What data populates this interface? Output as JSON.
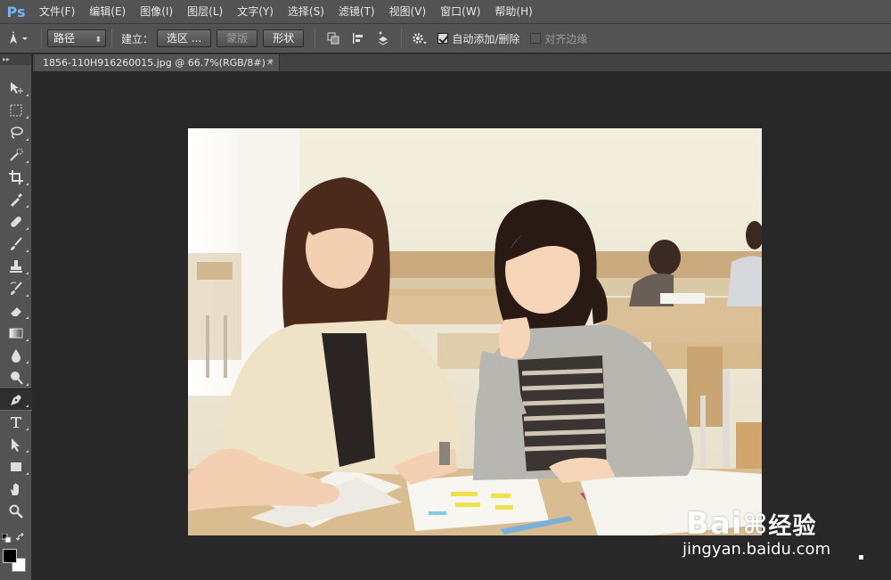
{
  "app": {
    "logo": "Ps"
  },
  "menu": [
    "文件(F)",
    "编辑(E)",
    "图像(I)",
    "图层(L)",
    "文字(Y)",
    "选择(S)",
    "滤镜(T)",
    "视图(V)",
    "窗口(W)",
    "帮助(H)"
  ],
  "options": {
    "mode_value": "路径",
    "make_label": "建立：",
    "selection_btn": "选区 ...",
    "mask_btn": "蒙版",
    "shape_btn": "形状",
    "auto_add_delete": "自动添加/删除",
    "align_edges": "对齐边缘"
  },
  "toolbar": {
    "head": "▸▸",
    "tools": [
      "move-tool-icon",
      "marquee-tool-icon",
      "lasso-tool-icon",
      "quick-select-icon",
      "crop-tool-icon",
      "eyedropper-icon",
      "healing-brush-icon",
      "brush-tool-icon",
      "clone-stamp-icon",
      "history-brush-icon",
      "eraser-icon",
      "gradient-icon",
      "blur-icon",
      "dodge-icon",
      "pen-tool-icon",
      "type-tool-icon",
      "path-select-icon",
      "rectangle-tool-icon",
      "hand-tool-icon",
      "zoom-tool-icon"
    ],
    "active": "pen-tool-icon"
  },
  "document": {
    "tab_title": "1856-110H916260015.jpg @ 66.7%(RGB/8#) *",
    "close": "×"
  },
  "watermark": {
    "brand": "Bai",
    "brand2": "经验",
    "url": "jingyan.baidu.com"
  },
  "colors": {
    "fg": "#000000",
    "bg": "#ffffff",
    "accent": "#6fb6ff"
  }
}
